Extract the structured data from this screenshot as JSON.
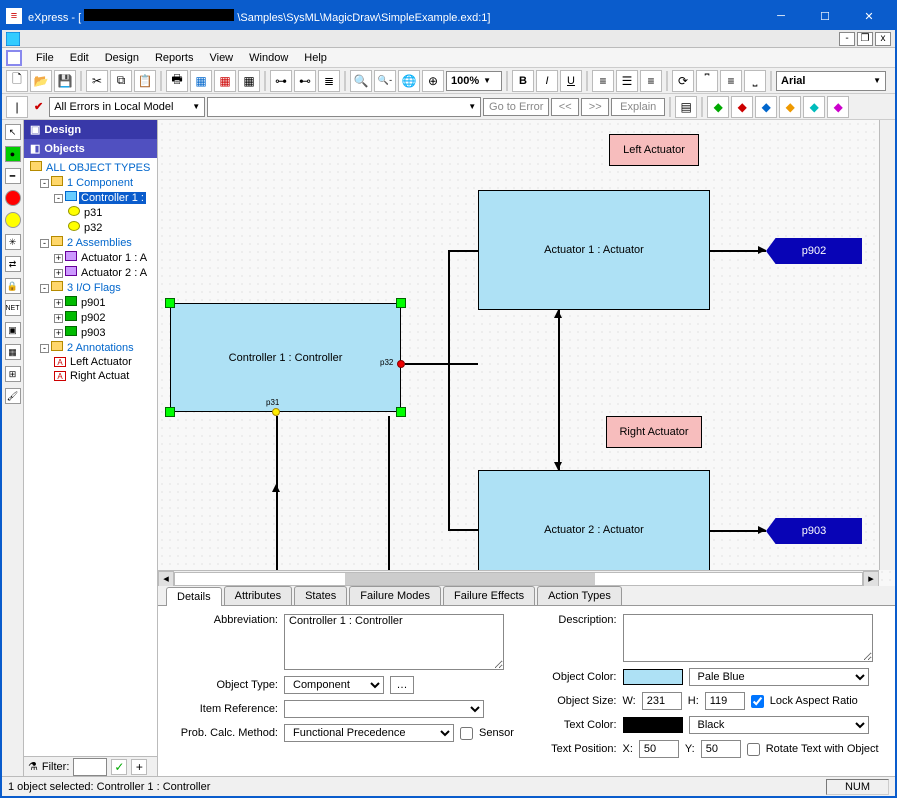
{
  "title": {
    "app": "eXpress",
    "path": "\\Samples\\SysML\\MagicDraw\\SimpleExample.exd:1]"
  },
  "menu": [
    "File",
    "Edit",
    "Design",
    "Reports",
    "View",
    "Window",
    "Help"
  ],
  "zoom": "100%",
  "font": "Arial",
  "errorsCombo": "All Errors in Local Model",
  "goto": "Go to Error",
  "explain": "Explain",
  "nav": {
    "design": "Design",
    "objects": "Objects"
  },
  "tree": {
    "root": "ALL OBJECT TYPES",
    "components": {
      "h": "1 Component",
      "items": [
        {
          "n": "Controller 1 : ",
          "sel": true,
          "ports": [
            "p31",
            "p32"
          ]
        }
      ]
    },
    "assemblies": {
      "h": "2 Assemblies",
      "items": [
        "Actuator 1 : A",
        "Actuator 2 : A"
      ]
    },
    "flags": {
      "h": "3 I/O Flags",
      "items": [
        "p901",
        "p902",
        "p903"
      ]
    },
    "annotations": {
      "h": "2 Annotations",
      "items": [
        "Left Actuator",
        "Right Actuat"
      ]
    }
  },
  "canvas": {
    "controller": "Controller 1 : Controller",
    "act1": "Actuator 1 : Actuator",
    "act2": "Actuator 2 : Actuator",
    "left": "Left Actuator",
    "right": "Right Actuator",
    "p31": "p31",
    "p32": "p32",
    "p902": "p902",
    "p903": "p903"
  },
  "tabs": [
    "Details",
    "Attributes",
    "States",
    "Failure Modes",
    "Failure Effects",
    "Action Types"
  ],
  "details": {
    "abbr_l": "Abbreviation:",
    "abbr_v": "Controller 1 : Controller",
    "otype_l": "Object Type:",
    "otype_v": "Component",
    "iref_l": "Item Reference:",
    "iref_v": "",
    "calc_l": "Prob. Calc. Method:",
    "calc_v": "Functional Precedence",
    "sensor_l": "Sensor",
    "desc_l": "Description:",
    "desc_v": "",
    "color_l": "Object Color:",
    "color_v": "Pale Blue",
    "color_hex": "#aee1f5",
    "size_l": "Object Size:",
    "w_l": "W:",
    "w_v": "231",
    "h_l": "H:",
    "h_v": "119",
    "lock_l": "Lock Aspect Ratio",
    "tcolor_l": "Text Color:",
    "tcolor_v": "Black",
    "tcolor_hex": "#000000",
    "tpos_l": "Text Position:",
    "x_l": "X:",
    "x_v": "50",
    "y_l": "Y:",
    "y_v": "50",
    "rot_l": "Rotate Text with Object"
  },
  "filter": "Filter:",
  "status": "1 object selected: Controller 1 : Controller",
  "num": "NUM"
}
